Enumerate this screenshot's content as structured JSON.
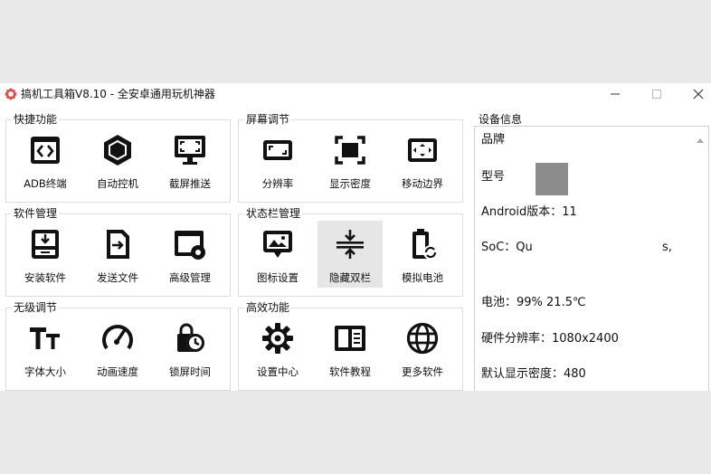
{
  "window": {
    "title": "搞机工具箱V8.10 - 全安卓通用玩机神器",
    "controls": {
      "minimize": "minimize",
      "maximize": "maximize",
      "close": "close"
    }
  },
  "groups": {
    "quick": {
      "label": "快捷功能",
      "items": [
        "ADB终端",
        "自动控机",
        "截屏推送"
      ]
    },
    "screen": {
      "label": "屏幕调节",
      "items": [
        "分辨率",
        "显示密度",
        "移动边界"
      ]
    },
    "software": {
      "label": "软件管理",
      "items": [
        "安装软件",
        "发送文件",
        "高级管理"
      ]
    },
    "statusbar": {
      "label": "状态栏管理",
      "items": [
        "图标设置",
        "隐藏双栏",
        "模拟电池"
      ]
    },
    "stepless": {
      "label": "无级调节",
      "items": [
        "字体大小",
        "动画速度",
        "锁屏时间"
      ]
    },
    "efficient": {
      "label": "高效功能",
      "items": [
        "设置中心",
        "软件教程",
        "更多软件"
      ]
    }
  },
  "selected_tile": "隐藏双栏",
  "device_info": {
    "label": "设备信息",
    "brand": "品牌",
    "model": "型号",
    "android": "Android版本：11",
    "soc": "SoC：Qu",
    "soc_tail": "s,",
    "battery": "电池：99%  21.5℃",
    "resolution": "硬件分辨率：1080x2400",
    "density": "默认显示密度：480"
  },
  "icons": {
    "app": "gear-flower-icon",
    "adb": "code-brackets-icon",
    "auto": "hexagon-icon",
    "screenshot": "monitor-capture-icon",
    "resolution": "aspect-ratio-icon",
    "density": "fullscreen-icon",
    "edge": "move-edges-icon",
    "install": "install-tray-icon",
    "send": "file-send-icon",
    "advanced": "window-gear-icon",
    "statusicon": "image-icon",
    "hidebar": "collapse-vertical-icon",
    "battery": "battery-sync-icon",
    "font": "text-size-icon",
    "speed": "speedometer-icon",
    "locktime": "lock-clock-icon",
    "settings": "gear-icon",
    "tutorial": "book-icon",
    "more": "globe-icon"
  },
  "colors": {
    "selected_bg": "#e6e6e6",
    "icon": "#111111",
    "redacted": "#8c8c8c",
    "app_icon": "#d9534f"
  }
}
